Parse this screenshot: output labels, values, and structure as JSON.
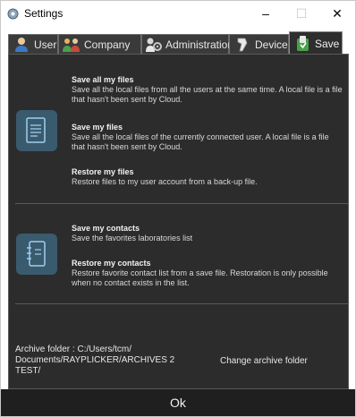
{
  "window": {
    "title": "Settings",
    "minimize": "–",
    "maximize": "☐",
    "close": "✕"
  },
  "tabs": [
    {
      "label": "User",
      "icon": "user-icon"
    },
    {
      "label": "Company",
      "icon": "company-icon"
    },
    {
      "label": "Administration",
      "icon": "administration-icon"
    },
    {
      "label": "Device",
      "icon": "device-icon"
    },
    {
      "label": "Save",
      "icon": "save-icon",
      "active": true
    }
  ],
  "files_section": {
    "icon": "document-icon",
    "items": [
      {
        "title": "Save all my files",
        "desc": "Save all the local files from all the users at the same time. A local file is a file that hasn't been sent by Cloud."
      },
      {
        "title": "Save my files",
        "desc": "Save all the local files of the currently connected user. A local file is a file that hasn't been sent by Cloud."
      },
      {
        "title": "Restore my files",
        "desc": "Restore files to my user account from a back-up file."
      }
    ]
  },
  "contacts_section": {
    "icon": "contacts-book-icon",
    "items": [
      {
        "title": "Save my contacts",
        "desc": "Save the favorites laboratories list"
      },
      {
        "title": "Restore my contacts",
        "desc": "Restore favorite contact list from a save file. Restoration is only possible when no contact exists in the list."
      }
    ]
  },
  "archive": {
    "folder_text": "Archive folder : C:/Users/tcm/ Documents/RAYPLICKER/ARCHIVES 2 TEST/",
    "change_label": "Change archive folder"
  },
  "footer": {
    "ok_label": "Ok"
  },
  "colors": {
    "panel_bg": "#2c2c2c",
    "icon_tile": "#3a5a6e",
    "footer_bg": "#1f1f1f"
  }
}
